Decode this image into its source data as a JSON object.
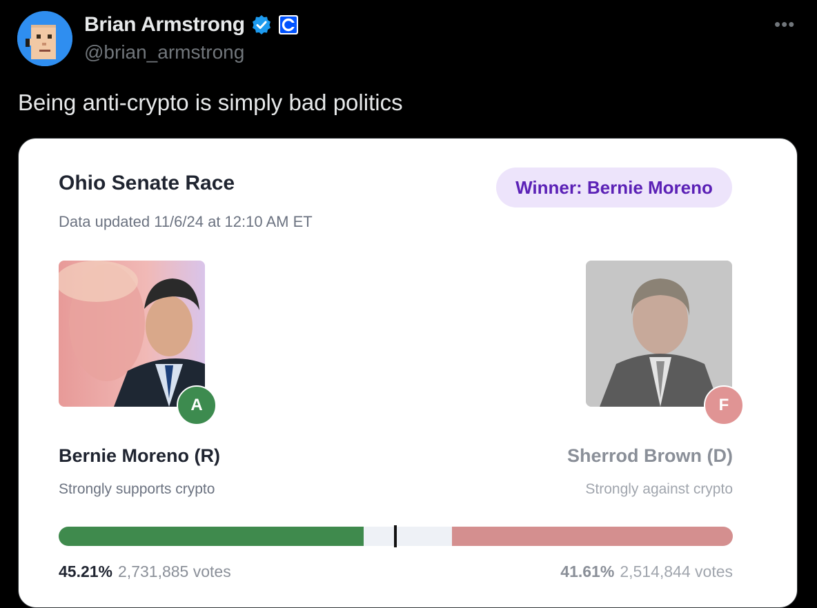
{
  "tweet": {
    "author_name": "Brian Armstrong",
    "author_handle": "@brian_armstrong",
    "more_label": "•••",
    "text": "Being anti-crypto is simply bad politics"
  },
  "card": {
    "title": "Ohio Senate Race",
    "updated": "Data updated 11/6/24 at 12:10 AM ET",
    "winner_label": "Winner: Bernie Moreno",
    "left": {
      "name": "Bernie Moreno (R)",
      "stance": "Strongly supports crypto",
      "grade": "A",
      "percent": "45.21%",
      "votes": "2,731,885 votes",
      "share": 0.4521
    },
    "right": {
      "name": "Sherrod Brown (D)",
      "stance": "Strongly against crypto",
      "grade": "F",
      "percent": "41.61%",
      "votes": "2,514,844 votes",
      "share": 0.4161
    }
  },
  "colors": {
    "accent_winner": "#5b21b6",
    "supporter_green": "#3f8a4d",
    "opponent_red": "#d48f8f",
    "verified_blue": "#1d9bf0",
    "coinbase_blue": "#0052ff"
  }
}
